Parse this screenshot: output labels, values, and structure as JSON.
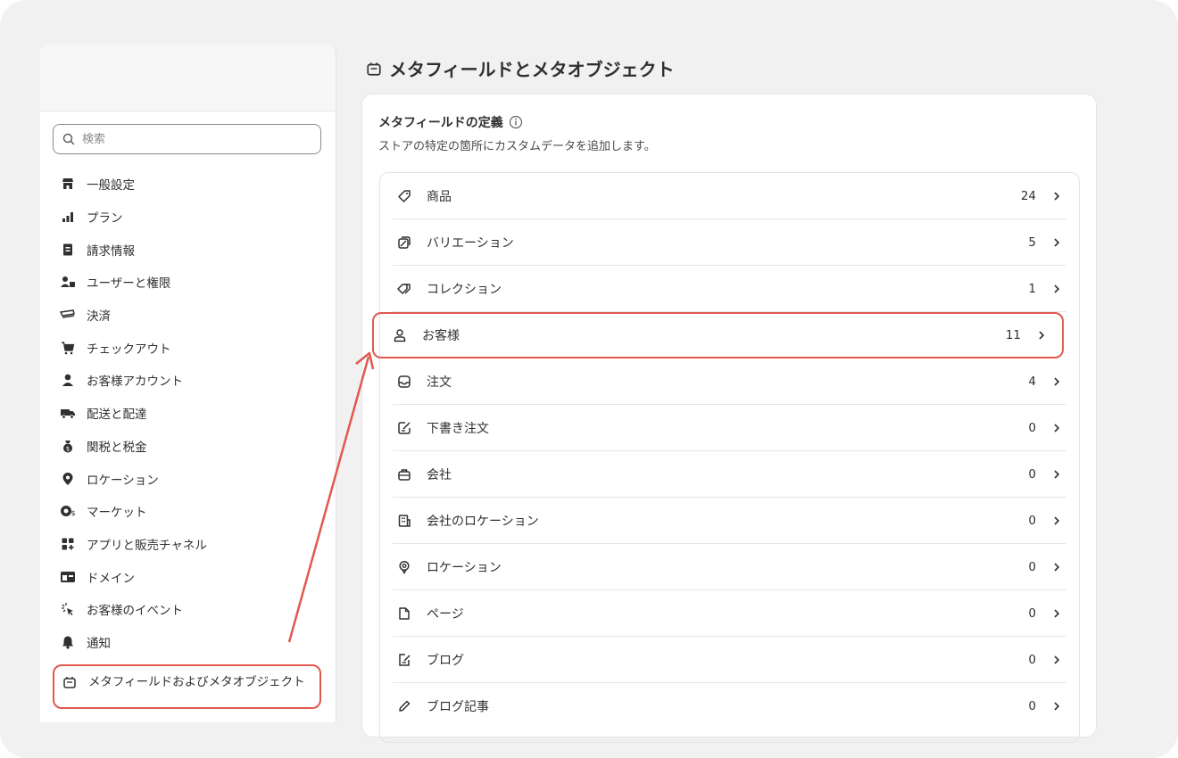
{
  "sidebar": {
    "search_placeholder": "検索",
    "items": [
      {
        "label": "一般設定",
        "icon": "store-icon"
      },
      {
        "label": "プラン",
        "icon": "plan-icon"
      },
      {
        "label": "請求情報",
        "icon": "billing-icon"
      },
      {
        "label": "ユーザーと権限",
        "icon": "users-icon"
      },
      {
        "label": "決済",
        "icon": "payments-icon"
      },
      {
        "label": "チェックアウト",
        "icon": "cart-icon"
      },
      {
        "label": "お客様アカウント",
        "icon": "person-icon"
      },
      {
        "label": "配送と配達",
        "icon": "truck-icon"
      },
      {
        "label": "関税と税金",
        "icon": "money-bag-icon"
      },
      {
        "label": "ロケーション",
        "icon": "location-icon"
      },
      {
        "label": "マーケット",
        "icon": "globe-icon"
      },
      {
        "label": "アプリと販売チャネル",
        "icon": "apps-icon"
      },
      {
        "label": "ドメイン",
        "icon": "domain-icon"
      },
      {
        "label": "お客様のイベント",
        "icon": "cursor-icon"
      },
      {
        "label": "通知",
        "icon": "bell-icon"
      }
    ],
    "active_item": {
      "label": "メタフィールドおよびメタオブジェクト",
      "icon": "metafield-icon"
    }
  },
  "main": {
    "title": "メタフィールドとメタオブジェクト",
    "card": {
      "title": "メタフィールドの定義",
      "description": "ストアの特定の箇所にカスタムデータを追加します。",
      "rows": [
        {
          "label": "商品",
          "count": "24",
          "icon": "tag-icon"
        },
        {
          "label": "バリエーション",
          "count": "5",
          "icon": "variant-icon"
        },
        {
          "label": "コレクション",
          "count": "1",
          "icon": "collection-icon"
        },
        {
          "label": "お客様",
          "count": "11",
          "icon": "person-outline-icon"
        },
        {
          "label": "注文",
          "count": "4",
          "icon": "inbox-icon"
        },
        {
          "label": "下書き注文",
          "count": "0",
          "icon": "draft-icon"
        },
        {
          "label": "会社",
          "count": "0",
          "icon": "company-icon"
        },
        {
          "label": "会社のロケーション",
          "count": "0",
          "icon": "building-icon"
        },
        {
          "label": "ロケーション",
          "count": "0",
          "icon": "pin-icon"
        },
        {
          "label": "ページ",
          "count": "0",
          "icon": "page-icon"
        },
        {
          "label": "ブログ",
          "count": "0",
          "icon": "blog-icon"
        },
        {
          "label": "ブログ記事",
          "count": "0",
          "icon": "pencil-icon"
        }
      ]
    }
  },
  "highlight_color": "#e0594f"
}
